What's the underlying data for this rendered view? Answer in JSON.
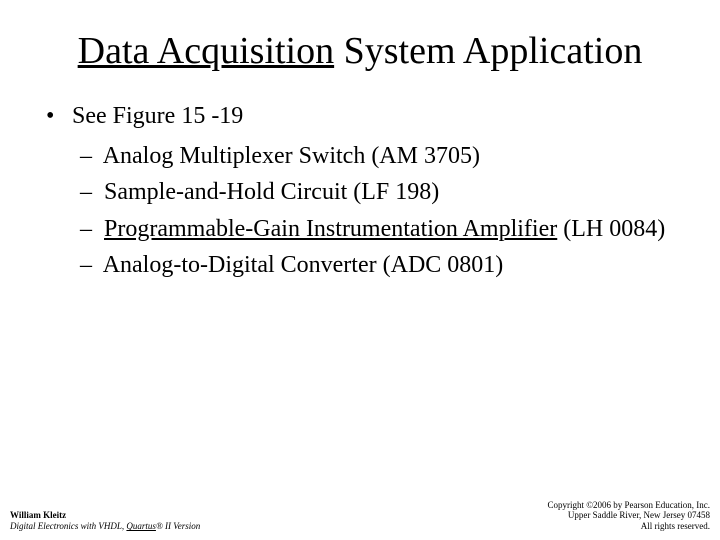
{
  "title": {
    "part_a": "Data Acquisition",
    "part_b": " System Application"
  },
  "bullet_lvl1": "See Figure 15 -19",
  "subitems": {
    "a": "Analog Multiplexer Switch (AM 3705)",
    "b": "Sample-and-Hold Circuit (LF 198)",
    "c_link": "Programmable-Gain Instrumentation Amplifier",
    "c_rest": " (LH 0084)",
    "d": "Analog-to-Digital Converter (ADC 0801)"
  },
  "footer": {
    "author": "William Kleitz",
    "book_a": "Digital Electronics with VHDL, ",
    "book_b": "Quartus",
    "book_c": "® II Version",
    "copy1": "Copyright ©2006 by Pearson Education, Inc.",
    "copy2": "Upper Saddle River, New Jersey 07458",
    "copy3": "All rights reserved."
  }
}
